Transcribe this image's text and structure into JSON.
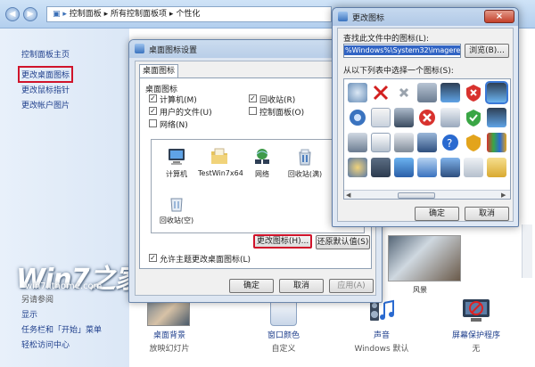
{
  "address": {
    "crumbs": [
      "控制面板",
      "所有控制面板项",
      "个性化"
    ]
  },
  "sidebar": {
    "home": "控制面板主页",
    "items": [
      "更改桌面图标",
      "更改鼠标指针",
      "更改帐户图片"
    ],
    "see_also_title": "另请参阅",
    "see_also": [
      "显示",
      "任务栏和「开始」菜单",
      "轻松访问中心"
    ]
  },
  "watermark": {
    "logo": "Win7之家",
    "url": "win7.ithome.com"
  },
  "desktop_icon_dialog": {
    "title": "桌面图标设置",
    "tab": "桌面图标",
    "group_label": "桌面图标",
    "checks": [
      {
        "label": "计算机(M)",
        "checked": true
      },
      {
        "label": "回收站(R)",
        "checked": true
      },
      {
        "label": "用户的文件(U)",
        "checked": true
      },
      {
        "label": "控制面板(O)",
        "checked": false
      },
      {
        "label": "网络(N)",
        "checked": false
      }
    ],
    "icons": [
      "计算机",
      "TestWin7x64",
      "网络",
      "回收站(满)",
      "回收站(空)"
    ],
    "change_icon_button": "更改图标(H)...",
    "restore_default_button": "还原默认值(S)",
    "allow_theme": "允许主题更改桌面图标(L)",
    "ok": "确定",
    "cancel": "取消",
    "apply": "应用(A)"
  },
  "change_icon_dialog": {
    "title": "更改图标",
    "find_label": "查找此文件中的图标(L):",
    "path": "%Windows%\\System32\\imageres.dll",
    "browse": "浏览(B)...",
    "select_label": "从以下列表中选择一个图标(S):",
    "ok": "确定",
    "cancel": "取消",
    "close_icon": "×"
  },
  "bottom_strip": [
    {
      "title": "桌面背景",
      "sub": "放映幻灯片"
    },
    {
      "title": "窗口颜色",
      "sub": "自定义"
    },
    {
      "title": "声音",
      "sub": "Windows 默认"
    },
    {
      "title": "屏幕保护程序",
      "sub": "无"
    }
  ],
  "theme_label": "风景",
  "colors": {
    "highlight_red": "#d0142b",
    "link_blue": "#1f3f8c",
    "selection_blue": "#3164c4"
  }
}
